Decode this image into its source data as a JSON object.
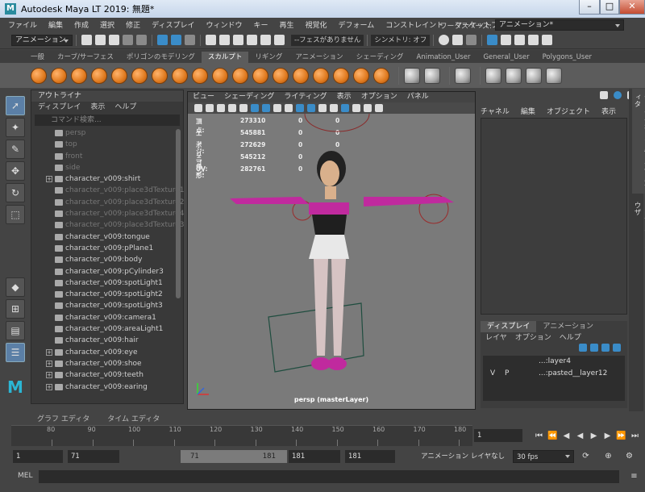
{
  "window": {
    "title": "Autodesk Maya LT 2019: 無題*",
    "logo": "M"
  },
  "menubar": [
    "ファイル",
    "編集",
    "作成",
    "選択",
    "修正",
    "ディスプレイ",
    "ウィンドウ",
    "キー",
    "再生",
    "視覚化",
    "デフォーム",
    "コンストレイント",
    "マーケットプレイス"
  ],
  "workspace": {
    "label": "ワークスペース:",
    "value": "アニメーション*"
  },
  "statusline": {
    "mode": "アニメーション",
    "surface_text": "--フェスがありません",
    "symmetry": "シンメトリ: オフ"
  },
  "shelf": {
    "tabs": [
      "一般",
      "カーブ/サーフェス",
      "ポリゴンのモデリング",
      "スカルプト",
      "リギング",
      "アニメーション",
      "シェーディング",
      "Animation_User",
      "General_User",
      "Polygons_User"
    ],
    "active_tab": "スカルプト"
  },
  "outliner": {
    "title": "アウトライナ",
    "menu": [
      "ディスプレイ",
      "表示",
      "ヘルプ"
    ],
    "search_placeholder": "コマンド検索...",
    "items": [
      {
        "label": "persp",
        "dim": true,
        "expand": false
      },
      {
        "label": "top",
        "dim": true,
        "expand": false
      },
      {
        "label": "front",
        "dim": true,
        "expand": false
      },
      {
        "label": "side",
        "dim": true,
        "expand": false
      },
      {
        "label": "character_v009:shirt",
        "dim": false,
        "expand": true
      },
      {
        "label": "character_v009:place3dTexture1",
        "dim": true,
        "expand": false
      },
      {
        "label": "character_v009:place3dTexture2",
        "dim": true,
        "expand": false
      },
      {
        "label": "character_v009:place3dTexture4",
        "dim": true,
        "expand": false
      },
      {
        "label": "character_v009:place3dTexture3",
        "dim": true,
        "expand": false
      },
      {
        "label": "character_v009:tongue",
        "dim": false,
        "expand": false
      },
      {
        "label": "character_v009:pPlane1",
        "dim": false,
        "expand": false
      },
      {
        "label": "character_v009:body",
        "dim": false,
        "expand": false
      },
      {
        "label": "character_v009:pCylinder3",
        "dim": false,
        "expand": false
      },
      {
        "label": "character_v009:spotLight1",
        "dim": false,
        "expand": false
      },
      {
        "label": "character_v009:spotLight2",
        "dim": false,
        "expand": false
      },
      {
        "label": "character_v009:spotLight3",
        "dim": false,
        "expand": false
      },
      {
        "label": "character_v009:camera1",
        "dim": false,
        "expand": false
      },
      {
        "label": "character_v009:areaLight1",
        "dim": false,
        "expand": false
      },
      {
        "label": "character_v009:hair",
        "dim": false,
        "expand": false
      },
      {
        "label": "character_v009:eye",
        "dim": false,
        "expand": true
      },
      {
        "label": "character_v009:shoe",
        "dim": false,
        "expand": true
      },
      {
        "label": "character_v009:teeth",
        "dim": false,
        "expand": true
      },
      {
        "label": "character_v009:earing",
        "dim": false,
        "expand": true
      }
    ]
  },
  "bottom_tabs": [
    "グラフ エディタ",
    "タイム エディタ"
  ],
  "viewport": {
    "menu": [
      "ビュー",
      "シェーディング",
      "ライティング",
      "表示",
      "オプション",
      "パネル"
    ],
    "hud": [
      {
        "label": "頂点:",
        "v1": "273310",
        "v2": "0",
        "v3": "0"
      },
      {
        "label": "エッジ:",
        "v1": "545881",
        "v2": "0",
        "v3": "0"
      },
      {
        "label": "ポリゴン:",
        "v1": "272629",
        "v2": "0",
        "v3": "0"
      },
      {
        "label": "三角形:",
        "v1": "545212",
        "v2": "0",
        "v3": "0"
      },
      {
        "label": "UV:",
        "v1": "282761",
        "v2": "0",
        "v3": "0"
      }
    ],
    "camera_label": "persp (masterLayer)"
  },
  "channelbox": {
    "menu": [
      "チャネル",
      "編集",
      "オブジェクト",
      "表示"
    ]
  },
  "layers": {
    "tabs": [
      "ディスプレイ",
      "アニメーション"
    ],
    "menu": [
      "レイヤ",
      "オプション",
      "ヘルプ"
    ],
    "rows": [
      {
        "v": "",
        "p": "",
        "name": "...:layer4"
      },
      {
        "v": "V",
        "p": "P",
        "name": "...:pasted__layer12"
      }
    ]
  },
  "sidebar_tabs": [
    "チャネル ボックス/レイヤ エディタ",
    "コンテンツ ブラウザ"
  ],
  "timeline": {
    "ticks": [
      "80",
      "90",
      "100",
      "110",
      "120",
      "130",
      "140",
      "150",
      "160",
      "170",
      "180"
    ],
    "current_frame": "1"
  },
  "range": {
    "start": "1",
    "range_start": "71",
    "slider_start": "71",
    "slider_end": "181",
    "range_end": "181",
    "end": "181",
    "anim_layer": "アニメーション レイヤなし",
    "fps": "30 fps"
  },
  "mel": {
    "label": "MEL"
  },
  "colors": {
    "accent": "#3a8cc8",
    "shelf_orange": "#e07a1f",
    "viewport_bg": "#7a7a7a"
  }
}
